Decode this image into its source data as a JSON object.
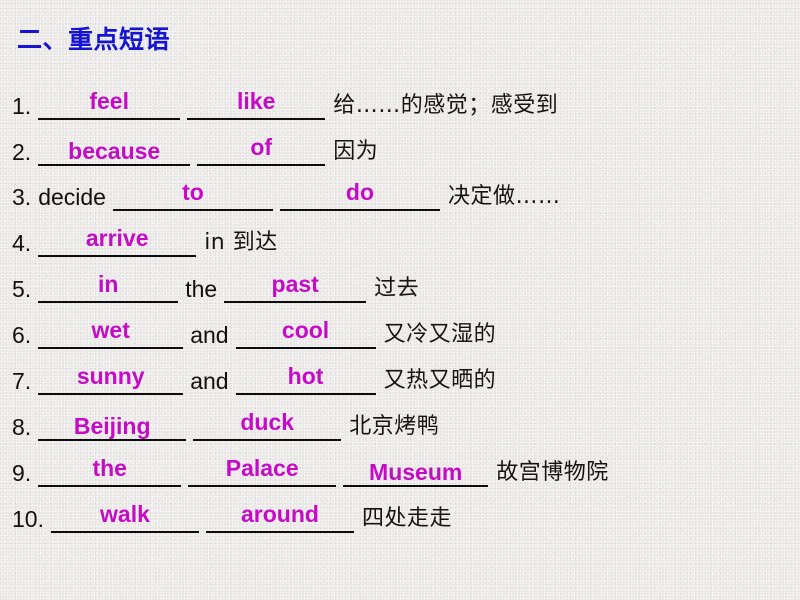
{
  "slide": {
    "title": "二、重点短语",
    "title_color": "#1414d2",
    "answer_color": "#c60bc6",
    "text_color": "#111111",
    "background_color": "#ecebe9"
  },
  "items": [
    {
      "number": "1.",
      "lead": "",
      "blanks": [
        "feel",
        "like"
      ],
      "mid": "",
      "translation": "给……的感觉；感受到"
    },
    {
      "number": "2.",
      "lead": "",
      "blanks": [
        "because",
        "of"
      ],
      "mid": "",
      "translation": "因为"
    },
    {
      "number": "3.",
      "lead": "decide",
      "blanks": [
        "to",
        "do"
      ],
      "mid": "",
      "translation": "决定做……"
    },
    {
      "number": "4.",
      "lead": "",
      "blanks": [
        "arrive"
      ],
      "mid": "",
      "translation": "in 到达"
    },
    {
      "number": "5.",
      "lead": "",
      "blanks": [
        "in",
        "past"
      ],
      "mid": "the",
      "translation": "过去"
    },
    {
      "number": "6.",
      "lead": "",
      "blanks": [
        "wet",
        "cool"
      ],
      "mid": "and",
      "translation": "又冷又湿的"
    },
    {
      "number": "7.",
      "lead": "",
      "blanks": [
        "sunny",
        "hot"
      ],
      "mid": "and",
      "translation": "又热又晒的"
    },
    {
      "number": "8.",
      "lead": "",
      "blanks": [
        "Beijing",
        "duck"
      ],
      "mid": "",
      "translation": "北京烤鸭"
    },
    {
      "number": "9.",
      "lead": "",
      "blanks": [
        "the",
        "Palace",
        "Museum"
      ],
      "mid": "",
      "translation": "故宫博物院"
    },
    {
      "number": "10.",
      "lead": "",
      "blanks": [
        "walk",
        "around"
      ],
      "mid": "",
      "translation": "四处走走"
    }
  ]
}
